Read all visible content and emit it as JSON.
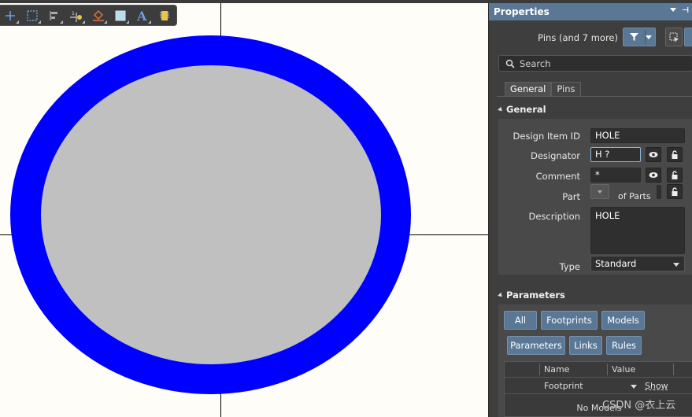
{
  "toolbar": {
    "tools": [
      {
        "name": "place-pin-icon",
        "glyph": "+"
      },
      {
        "name": "select-area-icon",
        "glyph": ""
      },
      {
        "name": "align-icon",
        "glyph": ""
      },
      {
        "name": "place-component-icon",
        "glyph": ""
      },
      {
        "name": "fill-icon",
        "glyph": ""
      },
      {
        "name": "rectangle-icon",
        "glyph": ""
      },
      {
        "name": "text-icon",
        "glyph": "A"
      },
      {
        "name": "ic-icon",
        "glyph": ""
      }
    ]
  },
  "panel": {
    "title": "Properties",
    "filter_label": "Pins (and 7 more)",
    "search_placeholder": "Search",
    "tabs": [
      "General",
      "Pins"
    ],
    "general": {
      "header": "General",
      "design_item_id_label": "Design Item ID",
      "design_item_id_value": "HOLE",
      "designator_label": "Designator",
      "designator_value": "H ?",
      "comment_label": "Comment",
      "comment_value": "*",
      "part_label": "Part",
      "of_parts_label": "of Parts",
      "description_label": "Description",
      "description_value": "HOLE",
      "type_label": "Type",
      "type_value": "Standard"
    },
    "parameters": {
      "header": "Parameters",
      "buttons_row1": [
        "All",
        "Footprints",
        "Models"
      ],
      "buttons_row2": [
        "Parameters",
        "Links",
        "Rules"
      ],
      "columns": [
        "Name",
        "Value"
      ],
      "row": {
        "name": "Footprint",
        "action": "Show"
      },
      "empty_text": "No Models"
    }
  },
  "canvas": {
    "outer_ring_color": "#0000ff",
    "inner_fill_color": "#c0c0c0",
    "background_color": "#fffdf8"
  },
  "colors": {
    "accent": "#5a7896",
    "panel_bg": "#3e3e3e"
  },
  "watermark": "CSDN @衣上云"
}
